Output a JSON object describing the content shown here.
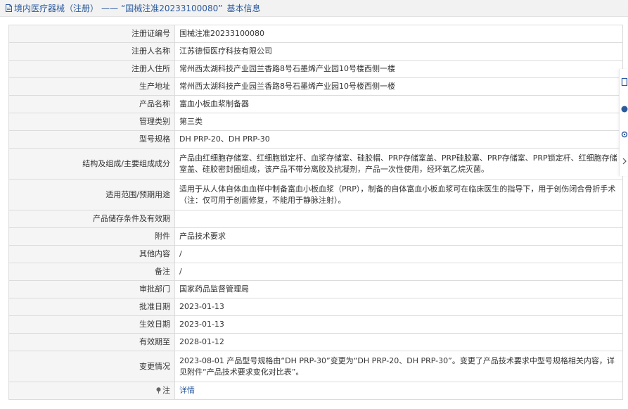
{
  "header": {
    "prefix": "境内医疗器械（注册）",
    "separator": "——",
    "main": "“国械注准20233100080”",
    "suffix": "基本信息"
  },
  "rows": [
    {
      "label": "注册证编号",
      "value": "国械注准20233100080"
    },
    {
      "label": "注册人名称",
      "value": "江苏德恒医疗科技有限公司"
    },
    {
      "label": "注册人住所",
      "value": "常州西太湖科技产业园兰香路8号石墨烯产业园10号楼西侧一楼"
    },
    {
      "label": "生产地址",
      "value": "常州西太湖科技产业园兰香路8号石墨烯产业园10号楼西侧一楼"
    },
    {
      "label": "产品名称",
      "value": "富血小板血浆制备器"
    },
    {
      "label": "管理类别",
      "value": "第三类"
    },
    {
      "label": "型号规格",
      "value": "DH PRP-20、DH PRP-30"
    },
    {
      "label": "结构及组成/主要组成成分",
      "value": "产品由红细胞存储室、红细胞锁定杆、血浆存储室、硅胶帽、PRP存储室盖、PRP硅胶塞、PRP存储室、PRP锁定杆、红细胞存储室盖、硅胶密封圈组成，该产品不带分离胶及抗凝剂，产品一次性使用，经环氧乙烷灭菌。"
    },
    {
      "label": "适用范围/预期用途",
      "value": "适用于从人体自体血血样中制备富血小板血浆（PRP），制备的自体富血小板血浆可在临床医生的指导下，用于创伤闭合骨折手术（注：仅可用于创面修复，不能用于静脉注射）。"
    },
    {
      "label": "产品储存条件及有效期",
      "value": ""
    },
    {
      "label": "附件",
      "value": "产品技术要求"
    },
    {
      "label": "其他内容",
      "value": "/"
    },
    {
      "label": "备注",
      "value": "/"
    },
    {
      "label": "审批部门",
      "value": "国家药品监督管理局"
    },
    {
      "label": "批准日期",
      "value": "2023-01-13"
    },
    {
      "label": "生效日期",
      "value": "2023-01-13"
    },
    {
      "label": "有效期至",
      "value": "2028-01-12"
    },
    {
      "label": "变更情况",
      "value": "2023-08-01 产品型号规格由“DH PRP-30”变更为“DH PRP-20、DH PRP-30”。变更了产品技术要求中型号规格相关内容，详见附件“产品技术要求变化对比表”。"
    }
  ],
  "note_row": {
    "label": "注",
    "link": "详情"
  },
  "colors": {
    "link": "#2a5a9e",
    "label_bg": "#f5f5f5",
    "border": "#dcdcdc",
    "header_bg": "#f2f2f2"
  }
}
